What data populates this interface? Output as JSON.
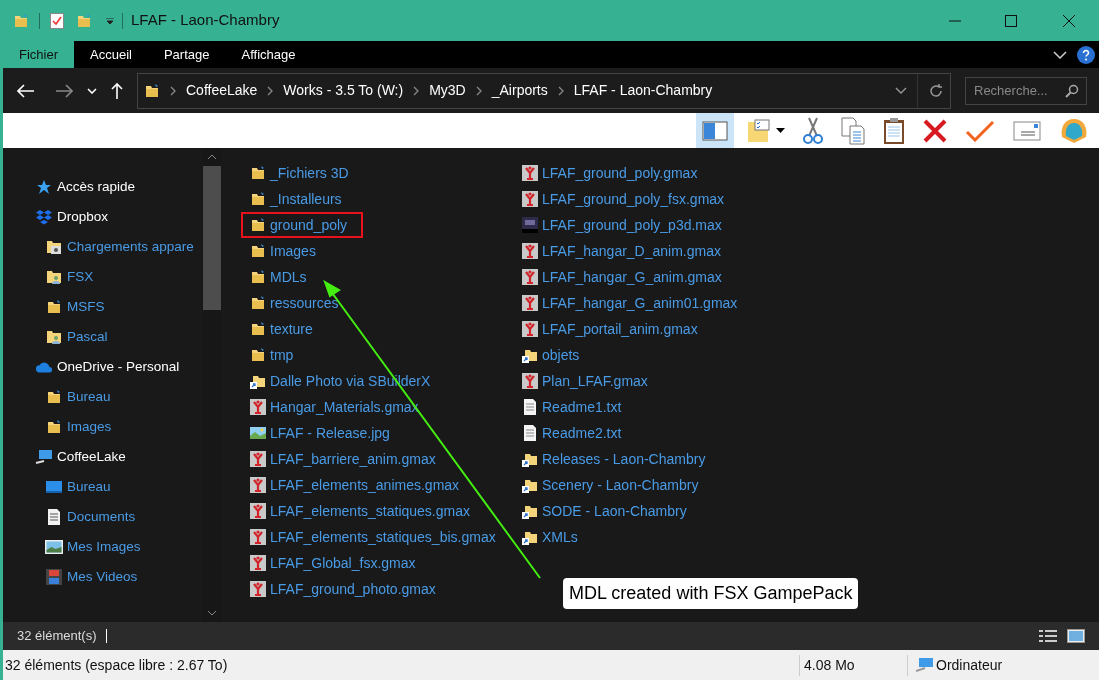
{
  "window": {
    "title": "LFAF - Laon-Chambry"
  },
  "ribbon_tabs": [
    {
      "label": "Fichier",
      "selected": true
    },
    {
      "label": "Accueil",
      "selected": false
    },
    {
      "label": "Partage",
      "selected": false
    },
    {
      "label": "Affichage",
      "selected": false
    }
  ],
  "breadcrumbs": [
    "CoffeeLake",
    "Works - 3.5 To (W:)",
    "My3D",
    "_Airports",
    "LFAF - Laon-Chambry"
  ],
  "search": {
    "placeholder": "Recherche..."
  },
  "toolbar": [
    {
      "kind": "pane",
      "selected": true
    },
    {
      "kind": "options",
      "selected": false
    },
    {
      "kind": "cut",
      "selected": false
    },
    {
      "kind": "copy",
      "selected": false
    },
    {
      "kind": "paste",
      "selected": false
    },
    {
      "kind": "delete",
      "selected": false
    },
    {
      "kind": "check",
      "selected": false
    },
    {
      "kind": "mail",
      "selected": false
    },
    {
      "kind": "shell",
      "selected": false
    }
  ],
  "sidebar": [
    {
      "label": "Accès rapide",
      "kind": "star"
    },
    {
      "label": "Dropbox",
      "kind": "dropbox",
      "children": [
        {
          "label": "Chargements appare",
          "kind": "camera"
        },
        {
          "label": "FSX",
          "kind": "people"
        },
        {
          "label": "MSFS",
          "kind": "folder"
        },
        {
          "label": "Pascal",
          "kind": "people"
        }
      ]
    },
    {
      "label": "OneDrive - Personal",
      "kind": "cloud",
      "children": [
        {
          "label": "Bureau",
          "kind": "folder"
        },
        {
          "label": "Images",
          "kind": "folder"
        }
      ]
    },
    {
      "label": "CoffeeLake",
      "kind": "pc",
      "children": [
        {
          "label": "Bureau",
          "kind": "desktop"
        },
        {
          "label": "Documents",
          "kind": "doc"
        },
        {
          "label": "Mes Images",
          "kind": "pictures"
        },
        {
          "label": "Mes Videos",
          "kind": "video"
        }
      ]
    }
  ],
  "files": [
    {
      "name": "_Fichiers 3D",
      "kind": "folder",
      "highlighted": false
    },
    {
      "name": "_Installeurs",
      "kind": "folder",
      "highlighted": false
    },
    {
      "name": "ground_poly",
      "kind": "folder",
      "highlighted": true
    },
    {
      "name": "Images",
      "kind": "folder",
      "highlighted": false
    },
    {
      "name": "MDLs",
      "kind": "folder",
      "highlighted": false
    },
    {
      "name": "ressources",
      "kind": "folder",
      "highlighted": false
    },
    {
      "name": "texture",
      "kind": "folder",
      "highlighted": false
    },
    {
      "name": "tmp",
      "kind": "folder",
      "highlighted": false
    },
    {
      "name": "Dalle Photo via SBuilderX",
      "kind": "shortcut",
      "highlighted": false
    },
    {
      "name": "Hangar_Materials.gmax",
      "kind": "gmax",
      "highlighted": false
    },
    {
      "name": "LFAF - Release.jpg",
      "kind": "image",
      "highlighted": false
    },
    {
      "name": "LFAF_barriere_anim.gmax",
      "kind": "gmax",
      "highlighted": false
    },
    {
      "name": "LFAF_elements_animes.gmax",
      "kind": "gmax",
      "highlighted": false
    },
    {
      "name": "LFAF_elements_statiques.gmax",
      "kind": "gmax",
      "highlighted": false
    },
    {
      "name": "LFAF_elements_statiques_bis.gmax",
      "kind": "gmax",
      "highlighted": false
    },
    {
      "name": "LFAF_Global_fsx.gmax",
      "kind": "gmax",
      "highlighted": false
    },
    {
      "name": "LFAF_ground_photo.gmax",
      "kind": "gmax",
      "highlighted": false
    },
    {
      "name": "LFAF_ground_poly.gmax",
      "kind": "gmax",
      "highlighted": false
    },
    {
      "name": "LFAF_ground_poly_fsx.gmax",
      "kind": "gmax",
      "highlighted": false
    },
    {
      "name": "LFAF_ground_poly_p3d.max",
      "kind": "max",
      "highlighted": false
    },
    {
      "name": "LFAF_hangar_D_anim.gmax",
      "kind": "gmax",
      "highlighted": false
    },
    {
      "name": "LFAF_hangar_G_anim.gmax",
      "kind": "gmax",
      "highlighted": false
    },
    {
      "name": "LFAF_hangar_G_anim01.gmax",
      "kind": "gmax",
      "highlighted": false
    },
    {
      "name": "LFAF_portail_anim.gmax",
      "kind": "gmax",
      "highlighted": false
    },
    {
      "name": "objets",
      "kind": "shortcut",
      "highlighted": false
    },
    {
      "name": "Plan_LFAF.gmax",
      "kind": "gmax",
      "highlighted": false
    },
    {
      "name": "Readme1.txt",
      "kind": "text",
      "highlighted": false
    },
    {
      "name": "Readme2.txt",
      "kind": "text",
      "highlighted": false
    },
    {
      "name": "Releases - Laon-Chambry",
      "kind": "shortcut",
      "highlighted": false
    },
    {
      "name": "Scenery - Laon-Chambry",
      "kind": "shortcut",
      "highlighted": false
    },
    {
      "name": "SODE - Laon-Chambry",
      "kind": "shortcut",
      "highlighted": false
    },
    {
      "name": "XMLs",
      "kind": "shortcut",
      "highlighted": false
    }
  ],
  "annotation": {
    "text": "MDL created with FSX GampePack"
  },
  "item_count": "32 élément(s)",
  "status_bar": {
    "summary": "32 éléments (espace libre : 2.67 To)",
    "size": "4.08 Mo",
    "location": "Ordinateur"
  }
}
